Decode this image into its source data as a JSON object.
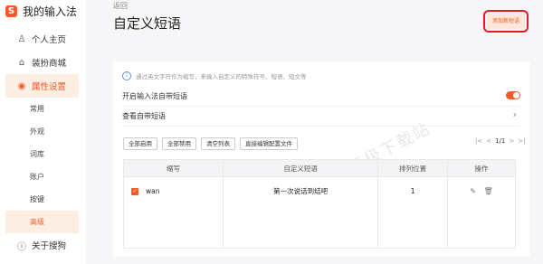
{
  "app": {
    "title": "我的输入法",
    "logo_glyph": "S",
    "accent": "#f35a26"
  },
  "sidebar": {
    "items": [
      {
        "label": "个人主页",
        "icon": "person-icon"
      },
      {
        "label": "装扮商城",
        "icon": "shirt-icon"
      },
      {
        "label": "属性设置",
        "icon": "settings-icon"
      }
    ],
    "sub_items": [
      "常用",
      "外观",
      "词库",
      "账户",
      "按键",
      "高级"
    ],
    "about": {
      "label": "关于搜狗",
      "icon": "info-icon"
    }
  },
  "header": {
    "back_label": "返回",
    "title": "自定义短语",
    "add_button": "添加新短语"
  },
  "panel": {
    "hint": "通过英文字符作为缩写，来输入自定义的特殊符号、短语、短文等",
    "enable_label": "开启输入法自带短语",
    "enable_on": true,
    "view_label": "查看自带短语",
    "buttons": [
      "全部启用",
      "全部禁用",
      "清空列表",
      "直接编辑配置文件"
    ],
    "pager": {
      "first": "|<",
      "prev": "<",
      "page": "1/1",
      "next": ">",
      "last": ">|"
    },
    "table": {
      "headers": [
        "缩写",
        "自定义短语",
        "排列位置",
        "操作"
      ],
      "rows": [
        {
          "abbr": "wan",
          "phrase": "第一次说话到结吧",
          "position": "1",
          "checked": true
        }
      ]
    },
    "watermark": "天极下载站"
  }
}
